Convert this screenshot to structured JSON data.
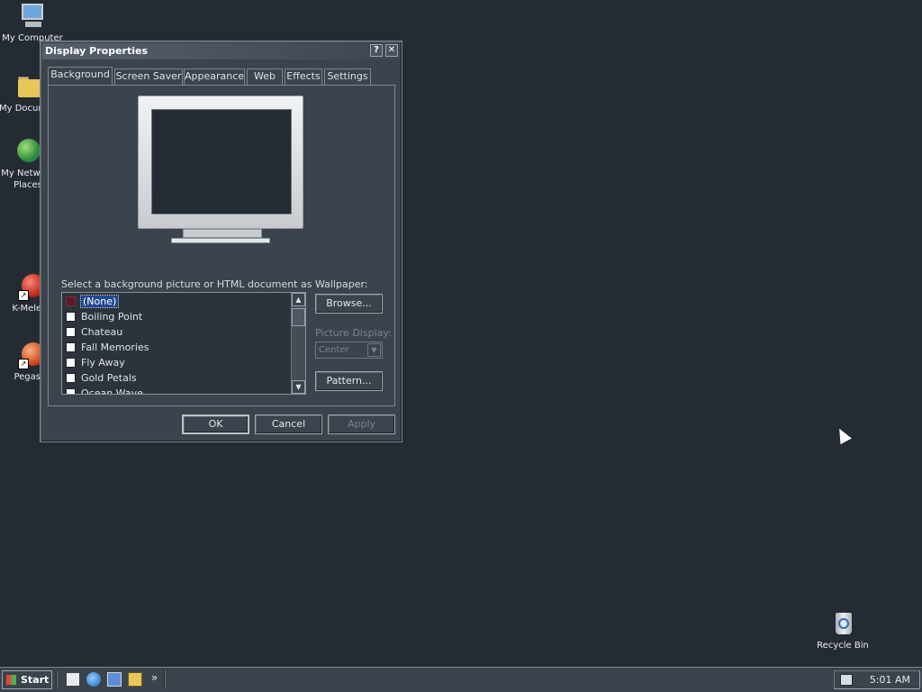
{
  "desktop": {
    "icons": [
      {
        "label": "My Computer",
        "icon": "my-computer-icon"
      },
      {
        "label": "My Documents",
        "icon": "my-documents-icon"
      },
      {
        "label": "My Network Places",
        "icon": "network-places-icon"
      },
      {
        "label": "K-Meleon",
        "icon": "kmeleon-icon"
      },
      {
        "label": "Pegasus",
        "icon": "pegasus-icon"
      },
      {
        "label": "Recycle Bin",
        "icon": "recycle-bin-icon"
      }
    ]
  },
  "window": {
    "title": "Display Properties",
    "help_button": "?",
    "close_button": "✕",
    "tabs": [
      {
        "label": "Background"
      },
      {
        "label": "Screen Saver"
      },
      {
        "label": "Appearance"
      },
      {
        "label": "Web"
      },
      {
        "label": "Effects"
      },
      {
        "label": "Settings"
      }
    ],
    "active_tab": "Background",
    "wallpaper_prompt": "Select a background picture or HTML document as Wallpaper:",
    "wallpaper_list": [
      {
        "label": "(None)",
        "selected": true
      },
      {
        "label": "Boiling Point"
      },
      {
        "label": "Chateau"
      },
      {
        "label": "Fall Memories"
      },
      {
        "label": "Fly Away"
      },
      {
        "label": "Gold Petals"
      },
      {
        "label": "Ocean Wave"
      }
    ],
    "browse_label": "Browse...",
    "picture_display_label": "Picture Display:",
    "picture_display_value": "Center",
    "pattern_label": "Pattern...",
    "ok_label": "OK",
    "cancel_label": "Cancel",
    "apply_label": "Apply"
  },
  "taskbar": {
    "start_label": "Start",
    "more_label": "»",
    "clock": "5:01 AM"
  }
}
